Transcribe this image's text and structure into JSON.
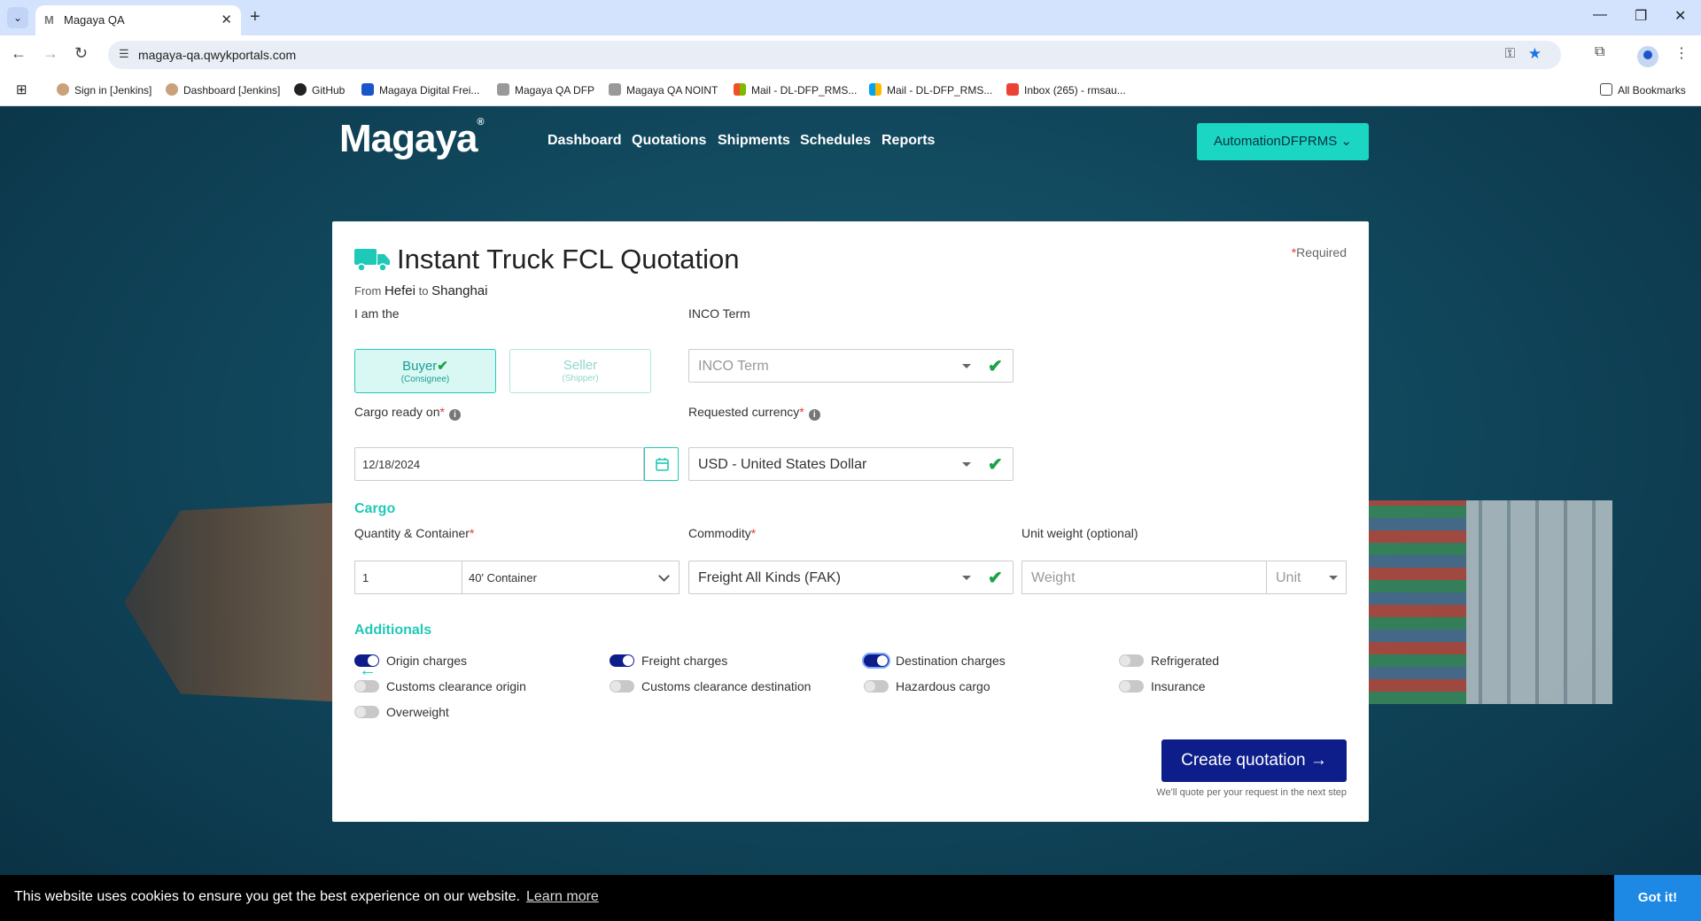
{
  "browser": {
    "tab_title": "Magaya QA",
    "url": "magaya-qa.qwykportals.com",
    "bookmarks": [
      "Sign in [Jenkins]",
      "Dashboard [Jenkins]",
      "GitHub",
      "Magaya Digital Frei...",
      "Magaya QA DFP",
      "Magaya QA NOINT",
      "Mail - DL-DFP_RMS...",
      "Mail - DL-DFP_RMS...",
      "Inbox (265) - rmsau...",
      "All Bookmarks"
    ]
  },
  "header": {
    "logo": "Magaya",
    "nav": [
      "Dashboard",
      "Quotations",
      "Shipments",
      "Schedules",
      "Reports"
    ],
    "account": "AutomationDFPRMS"
  },
  "quote": {
    "title": "Instant Truck FCL Quotation",
    "from_label": "From",
    "origin": "Hefei",
    "to_label": "to",
    "destination": "Shanghai",
    "required_note": "Required",
    "i_am_label": "I am the",
    "buyer": "Buyer",
    "buyer_sub": "(Consignee)",
    "seller": "Seller",
    "seller_sub": "(Shipper)",
    "inco_label": "INCO Term",
    "inco_placeholder": "INCO Term",
    "cargo_ready_label": "Cargo ready on",
    "cargo_ready_value": "12/18/2024",
    "currency_label": "Requested currency",
    "currency_value": "USD - United States Dollar",
    "cargo_section": "Cargo",
    "quantity_label": "Quantity & Container",
    "quantity_value": "1",
    "container_value": "40' Container",
    "commodity_label": "Commodity",
    "commodity_value": "Freight All Kinds (FAK)",
    "unit_weight_label": "Unit weight (optional)",
    "weight_placeholder": "Weight",
    "unit_placeholder": "Unit",
    "additionals_section": "Additionals",
    "additionals": [
      {
        "label": "Origin charges",
        "on": true
      },
      {
        "label": "Freight charges",
        "on": true
      },
      {
        "label": "Destination charges",
        "on": true
      },
      {
        "label": "Refrigerated",
        "on": false
      },
      {
        "label": "Customs clearance origin",
        "on": false
      },
      {
        "label": "Customs clearance destination",
        "on": false
      },
      {
        "label": "Hazardous cargo",
        "on": false
      },
      {
        "label": "Insurance",
        "on": false
      },
      {
        "label": "Overweight",
        "on": false
      }
    ],
    "create_button": "Create quotation",
    "create_note": "We'll quote per your request in the next step"
  },
  "cookie": {
    "text": "This website uses cookies to ensure you get the best experience on our website.",
    "link": "Learn more",
    "button": "Got it!"
  },
  "colors": {
    "accent": "#1fc9b7",
    "primary": "#0d1d8a",
    "check": "#1aa34a"
  }
}
